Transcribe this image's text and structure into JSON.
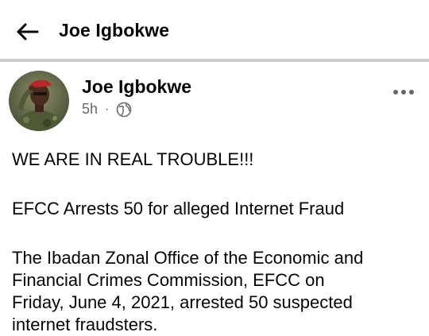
{
  "header": {
    "title": "Joe Igbokwe",
    "back_icon": "arrow-left-icon"
  },
  "post": {
    "author": "Joe Igbokwe",
    "time": "5h",
    "separator": "·",
    "privacy_icon": "globe-icon",
    "more_icon": "more-horizontal-icon",
    "paragraphs": [
      "WE ARE IN REAL TROUBLE!!!",
      "EFCC Arrests 50 for alleged Internet Fraud",
      "The Ibadan Zonal Office of the Economic and\nFinancial Crimes Commission, EFCC on\nFriday, June 4, 2021, arrested 50 suspected\ninternet fraudsters."
    ]
  },
  "colors": {
    "text": "#050505",
    "secondary": "#65676b",
    "divider": "#c9ccd1"
  }
}
